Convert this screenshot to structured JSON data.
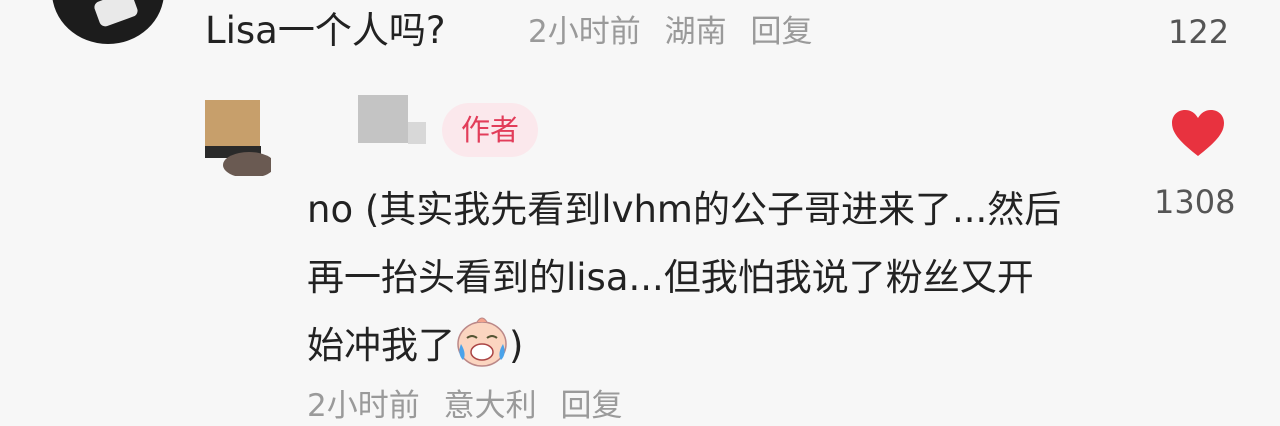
{
  "top_comment": {
    "text": "Lisa一个人吗?",
    "time": "2小时前",
    "location": "湖南",
    "reply_label": "回复",
    "like_count": "122"
  },
  "reply": {
    "author_badge": "作者",
    "text_part1": "no (其实我先看到lvhm的公子哥进来了...然后再一抬头看到的lisa...但我怕我说了粉丝又开始冲我了",
    "text_part2": ")",
    "emoji": "crying-laughing-face",
    "time": "2小时前",
    "location": "意大利",
    "reply_label": "回复",
    "like_count": "1308",
    "liked": true,
    "heart_color": "#e8323f"
  }
}
